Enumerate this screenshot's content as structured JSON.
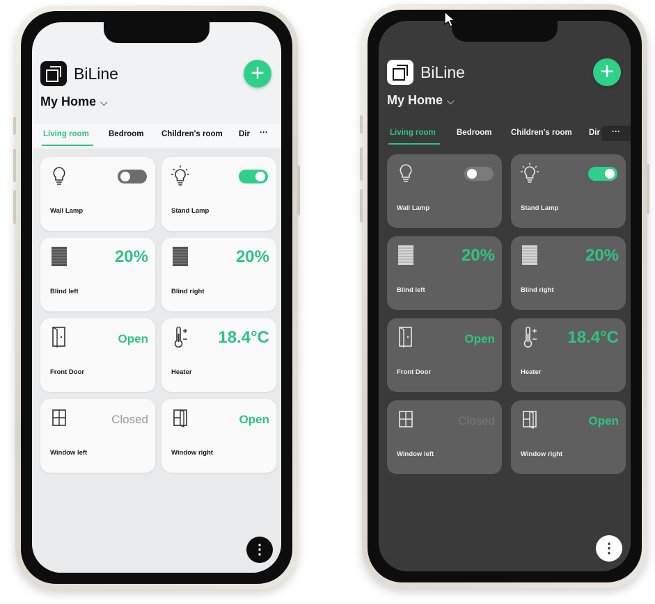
{
  "brand": "BiLine",
  "home": "My Home",
  "add_icon": "plus-icon",
  "colors": {
    "accent": "#2fc483",
    "light_bg": "#f1f2f4",
    "dark_bg": "#3a3a3a",
    "dark_card": "#5f5f5f"
  },
  "tabs": [
    "Living room",
    "Bedroom",
    "Children's room",
    "Dir"
  ],
  "more": "···",
  "devices": [
    {
      "label": "Wall Lamp",
      "icon": "bulb-off-icon",
      "type": "toggle",
      "on": false
    },
    {
      "label": "Stand Lamp",
      "icon": "bulb-on-icon",
      "type": "toggle",
      "on": true
    },
    {
      "label": "Blind left",
      "icon": "blind-icon",
      "type": "value",
      "value": "20%"
    },
    {
      "label": "Blind right",
      "icon": "blind-icon",
      "type": "value",
      "value": "20%"
    },
    {
      "label": "Front Door",
      "icon": "door-icon",
      "type": "value",
      "value": "Open"
    },
    {
      "label": "Heater",
      "icon": "thermometer-icon",
      "type": "value",
      "value": "18.4°C"
    },
    {
      "label": "Window left",
      "icon": "window-icon",
      "type": "value",
      "value": "Closed"
    },
    {
      "label": "Window right",
      "icon": "window-open-icon",
      "type": "value",
      "value": "Open"
    }
  ],
  "fab_icon": "more-vertical-icon",
  "fab_glyph": "⋮"
}
